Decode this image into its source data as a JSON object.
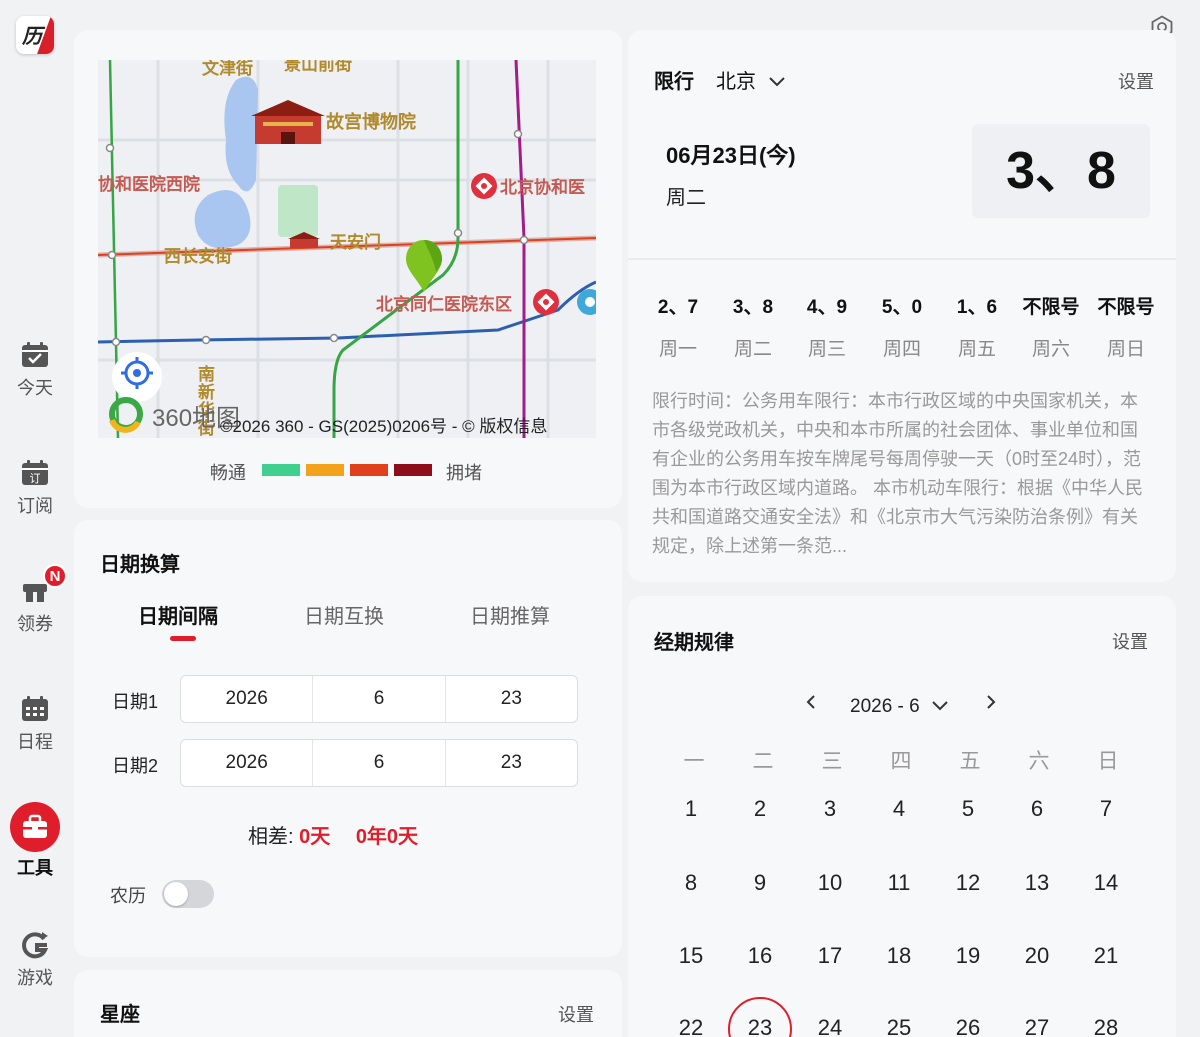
{
  "app": {
    "logo_text": "历"
  },
  "sidebar": {
    "items": [
      {
        "label": "今天",
        "icon": "calendar-check-icon"
      },
      {
        "label": "订阅",
        "icon": "calendar-subscribe-icon"
      },
      {
        "label": "领券",
        "icon": "coupon-icon",
        "badge": "N"
      },
      {
        "label": "日程",
        "icon": "calendar-grid-icon"
      },
      {
        "label": "工具",
        "icon": "toolbox-icon",
        "active": true
      },
      {
        "label": "游戏",
        "icon": "game-icon"
      }
    ]
  },
  "map": {
    "labels": {
      "top1": "文津街",
      "top2": "景山前街",
      "palace": "故宫博物院",
      "hospital_west": "协和医院西院",
      "hospital_east": "北京协和医",
      "chang_an": "西长安街",
      "tiananmen": "天安门",
      "tongren": "北京同仁医院东区",
      "south": "南新华街"
    },
    "brand": "360地图",
    "copyright": "©2026 360 - GS(2025)0206号 - © 版权信息"
  },
  "legend": {
    "left": "畅通",
    "right": "拥堵",
    "colors": [
      "#3fcf8e",
      "#f2a21b",
      "#e0401c",
      "#8e0d1b"
    ]
  },
  "date_calc": {
    "title": "日期换算",
    "tabs": [
      "日期间隔",
      "日期互换",
      "日期推算"
    ],
    "date1_label": "日期1",
    "date1": [
      "2026",
      "6",
      "23"
    ],
    "date2_label": "日期2",
    "date2": [
      "2026",
      "6",
      "23"
    ],
    "diff_label": "相差:",
    "diff_days": "0天",
    "diff_ym": "0年0天",
    "lunar_label": "农历"
  },
  "star": {
    "title": "星座",
    "settings": "设置"
  },
  "restriction": {
    "title": "限行",
    "city": "北京",
    "settings": "设置",
    "date": "06月23日(今)",
    "weekday": "周二",
    "today_numbers": "3、8",
    "week": [
      {
        "nums": "2、7",
        "day": "周一"
      },
      {
        "nums": "3、8",
        "day": "周二"
      },
      {
        "nums": "4、9",
        "day": "周三"
      },
      {
        "nums": "5、0",
        "day": "周四"
      },
      {
        "nums": "1、6",
        "day": "周五"
      },
      {
        "nums": "不限号",
        "day": "周六"
      },
      {
        "nums": "不限号",
        "day": "周日"
      }
    ],
    "desc": "限行时间：公务用车限行：本市行政区域的中央国家机关，本市各级党政机关，中央和本市所属的社会团体、事业单位和国有企业的公务用车按车牌尾号每周停驶一天（0时至24时），范围为本市行政区域内道路。 本市机动车限行：根据《中华人民共和国道路交通安全法》和《北京市大气污染防治条例》有关规定，除上述第一条范..."
  },
  "period": {
    "title": "经期规律",
    "settings": "设置",
    "month": "2026 - 6",
    "headers": [
      "一",
      "二",
      "三",
      "四",
      "五",
      "六",
      "日"
    ],
    "weeks": [
      [
        "1",
        "2",
        "3",
        "4",
        "5",
        "6",
        "7"
      ],
      [
        "8",
        "9",
        "10",
        "11",
        "12",
        "13",
        "14"
      ],
      [
        "15",
        "16",
        "17",
        "18",
        "19",
        "20",
        "21"
      ],
      [
        "22",
        "23",
        "24",
        "25",
        "26",
        "27",
        "28"
      ]
    ],
    "today": "23"
  }
}
